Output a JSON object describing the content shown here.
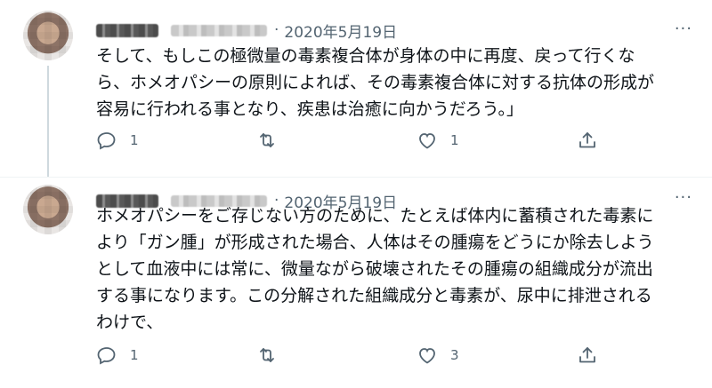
{
  "tweets": [
    {
      "date": "2020年5月19日",
      "separator": "·",
      "more": "···",
      "text": "そして、もしこの極微量の毒素複合体が身体の中に再度、戻って行くな\nら、ホメオパシーの原則によれば、その毒素複合体に対する抗体の形成が\n容易に行われる事となり、疾患は治癒に向かうだろう。」",
      "replies": "1",
      "retweets": "",
      "likes": "1"
    },
    {
      "date": "2020年5月19日",
      "separator": "·",
      "more": "···",
      "text": "ホメオパシーをご存じない方のために、たとえば体内に蓄積された毒素に\nより「ガン腫」が形成された場合、人体はその腫瘍をどうにか除去しよう\nとして血液中には常に、微量ながら破壊されたその腫瘍の組織成分が流出\nする事になります。この分解された組織成分と毒素が、尿中に排泄される\nわけで、",
      "replies": "1",
      "retweets": "",
      "likes": "3"
    }
  ],
  "icons": {
    "reply": "reply-icon",
    "retweet": "retweet-icon",
    "like": "heart-icon",
    "share": "share-icon",
    "color": "#536471"
  }
}
